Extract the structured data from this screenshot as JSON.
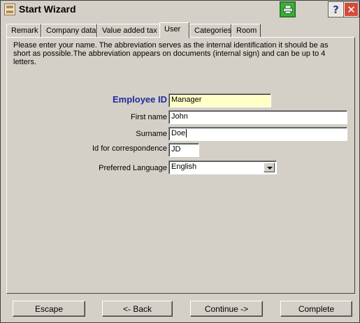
{
  "window": {
    "title": "Start Wizard",
    "icons": {
      "app": "app-icon",
      "print": "printer-icon",
      "help": "help-icon",
      "close": "close-icon"
    },
    "help_glyph": "?",
    "close_glyph": "✕"
  },
  "tabs": [
    {
      "label": "Remark"
    },
    {
      "label": "Company data"
    },
    {
      "label": "Value added tax"
    },
    {
      "label": "User",
      "active": true
    },
    {
      "label": "Categories"
    },
    {
      "label": "Room"
    }
  ],
  "intro": "Please enter your name. The abbreviation serves as the internal identification it should be as short as possible.The abbreviation appears on documents (internal sign) and can be up to 4 letters.",
  "form": {
    "employee_id": {
      "label": "Employee ID",
      "value": "Manager"
    },
    "first_name": {
      "label": "First name",
      "value": "John"
    },
    "surname": {
      "label": "Surname",
      "value": "Doe"
    },
    "correspondence_id": {
      "label": "Id for correspondence",
      "value": "JD"
    },
    "preferred_language": {
      "label": "Preferred Language",
      "value": "English"
    }
  },
  "buttons": {
    "escape": "Escape",
    "back": "<- Back",
    "continue": "Continue ->",
    "complete": "Complete"
  },
  "colors": {
    "employee_label": "#1f2a9c",
    "employee_field_bg": "#ffffc6",
    "print_button": "#3cae3c",
    "close_button": "#d54a3a"
  }
}
